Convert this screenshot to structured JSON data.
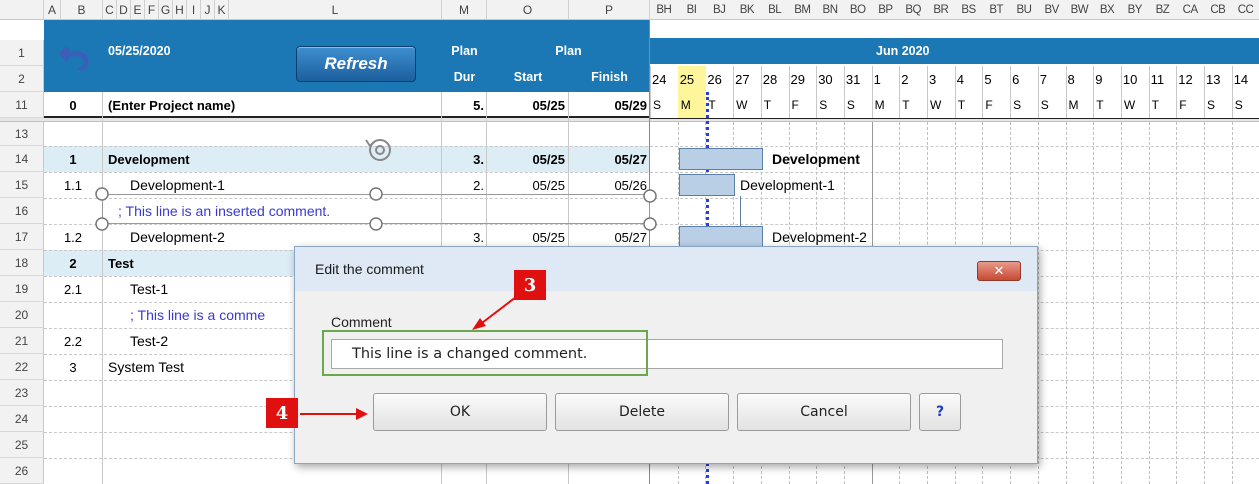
{
  "columns": {
    "left": [
      "A",
      "B",
      "C",
      "D",
      "E",
      "F",
      "G",
      "H",
      "I",
      "J",
      "K",
      "L",
      "M",
      "O",
      "P"
    ],
    "gantt": [
      "BH",
      "BI",
      "BJ",
      "BK",
      "BL",
      "BM",
      "BN",
      "BO",
      "BP",
      "BQ",
      "BR",
      "BS",
      "BT",
      "BU",
      "BV",
      "BW",
      "BX",
      "BY",
      "BZ",
      "CA",
      "CB",
      "CC"
    ]
  },
  "header": {
    "date": "05/25/2020",
    "refresh_label": "Refresh",
    "plan_dur_line1": "Plan",
    "plan_dur_line2": "Dur",
    "plan_label": "Plan",
    "start_label": "Start",
    "finish_label": "Finish",
    "month_label": "Jun 2020",
    "days": [
      "24",
      "25",
      "26",
      "27",
      "28",
      "29",
      "30",
      "31",
      "1",
      "2",
      "3",
      "4",
      "5",
      "6",
      "7",
      "8",
      "9",
      "10",
      "11",
      "12",
      "13",
      "14"
    ],
    "weekdays": [
      "S",
      "M",
      "T",
      "W",
      "T",
      "F",
      "S",
      "S",
      "M",
      "T",
      "W",
      "T",
      "F",
      "S",
      "S",
      "M",
      "T",
      "W",
      "T",
      "F",
      "S",
      "S"
    ],
    "today_index": 1
  },
  "rows": [
    {
      "row": "1"
    },
    {
      "row": "2"
    },
    {
      "row": "11",
      "id": "0",
      "task": "(Enter Project name)",
      "dur": "5.",
      "start": "05/25",
      "finish": "05/29"
    },
    {
      "row": "13"
    },
    {
      "row": "14",
      "id": "1",
      "task": "Development",
      "dur": "3.",
      "start": "05/25",
      "finish": "05/27"
    },
    {
      "row": "15",
      "id": "1.1",
      "task": "Development-1",
      "dur": "2.",
      "start": "05/25",
      "finish": "05/26"
    },
    {
      "row": "16",
      "comment": "; This line is an inserted comment."
    },
    {
      "row": "17",
      "id": "1.2",
      "task": "Development-2",
      "dur": "3.",
      "start": "05/25",
      "finish": "05/27"
    },
    {
      "row": "18",
      "id": "2",
      "task": "Test"
    },
    {
      "row": "19",
      "id": "2.1",
      "task": "Test-1"
    },
    {
      "row": "20",
      "comment": "; This line is a comme"
    },
    {
      "row": "21",
      "id": "2.2",
      "task": "Test-2"
    },
    {
      "row": "22",
      "id": "3",
      "task": "System Test"
    },
    {
      "row": "23"
    },
    {
      "row": "24"
    },
    {
      "row": "25"
    },
    {
      "row": "26"
    }
  ],
  "gantt_labels": {
    "development": "Development",
    "development_1": "Development-1",
    "development_2": "Development-2"
  },
  "dialog": {
    "title": "Edit the comment",
    "close_label": "✕",
    "comment_label": "Comment",
    "comment_value": "This line is a changed comment.",
    "ok_label": "OK",
    "delete_label": "Delete",
    "cancel_label": "Cancel",
    "help_label": "?"
  },
  "callouts": {
    "step3": "3",
    "step4": "4"
  },
  "colors": {
    "header_blue": "#1b78b4",
    "today_yellow": "#fff59a",
    "bar_fill": "#b9cfe6",
    "marker_red": "#e01010",
    "highlight_green": "#6aa84f",
    "comment_blue": "#3a3ad0"
  }
}
